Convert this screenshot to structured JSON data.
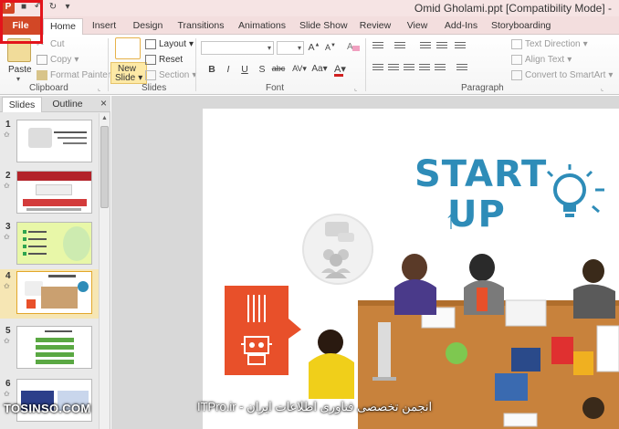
{
  "window": {
    "title": "Omid Gholami.ppt [Compatibility Mode] -"
  },
  "tabs": [
    "File",
    "Home",
    "Insert",
    "Design",
    "Transitions",
    "Animations",
    "Slide Show",
    "Review",
    "View",
    "Add-Ins",
    "Storyboarding"
  ],
  "ribbon": {
    "clipboard": {
      "label": "Clipboard",
      "paste": "Paste",
      "cut": "Cut",
      "copy": "Copy",
      "format_painter": "Format Painter"
    },
    "slides": {
      "label": "Slides",
      "new_slide_line1": "New",
      "new_slide_line2": "Slide",
      "layout": "Layout",
      "reset": "Reset",
      "section": "Section"
    },
    "font": {
      "label": "Font",
      "bold": "B",
      "italic": "I",
      "underline": "U",
      "shadow": "S",
      "strike": "abc",
      "spacing": "AV",
      "case": "Aa",
      "grow": "A",
      "shrink": "A"
    },
    "paragraph": {
      "label": "Paragraph",
      "text_direction": "Text Direction",
      "align_text": "Align Text",
      "convert_smartart": "Convert to SmartArt"
    }
  },
  "pane": {
    "tab_slides": "Slides",
    "tab_outline": "Outline",
    "close": "×"
  },
  "slides": [
    {
      "num": "1",
      "selected": false
    },
    {
      "num": "2",
      "selected": false
    },
    {
      "num": "3",
      "selected": false
    },
    {
      "num": "4",
      "selected": true
    },
    {
      "num": "5",
      "selected": false
    },
    {
      "num": "6",
      "selected": false
    }
  ],
  "slide_content": {
    "title_line1": "START",
    "title_line2": "UP"
  },
  "watermark": {
    "left": "TOSINSO.COM",
    "right": "ITPro.ir - انجمن تخصصی فناوری اطلاعات ایران"
  },
  "colors": {
    "accent": "#d24726",
    "highlight_box": "#e3141b",
    "startup_blue": "#2e8cb8",
    "orange": "#e8502a",
    "table": "#c8823c"
  }
}
